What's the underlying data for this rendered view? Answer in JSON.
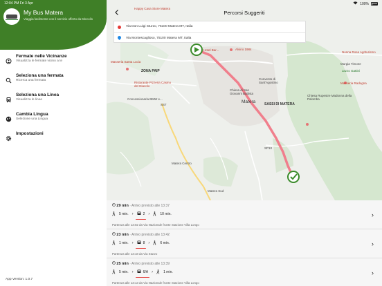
{
  "status_bar": {
    "time": "12:04 PM  Fri 3 Apr",
    "battery": "100%"
  },
  "drawer": {
    "app_title": "My Bus Matera",
    "app_subtitle": "Viaggia facilmente con il servizio offerto da Miccolis",
    "menu": [
      {
        "title": "Fermate nelle Vicinanze",
        "subtitle": "Visualizza le fermate vicino a te",
        "icon": "walking-icon"
      },
      {
        "title": "Seleziona una fermata",
        "subtitle": "Ricerca una fermata",
        "icon": "search-icon"
      },
      {
        "title": "Seleziona una Linea",
        "subtitle": "Visualizza le linee",
        "icon": "bus-icon"
      },
      {
        "title": "Cambia Lingua",
        "subtitle": "Selezione una Lingua",
        "icon": "globe-icon"
      },
      {
        "title": "Impostazioni",
        "subtitle": "",
        "icon": "gear-icon"
      }
    ],
    "version": "App Version: 1.0.7"
  },
  "header": {
    "title": "Percorsi Suggeriti",
    "back_icon": "chevron-left-icon"
  },
  "route": {
    "from": "Via Don Luigi Sturzo, 75100 Matera MT, Italia",
    "to": "Via Montescaglioso, 75100 Matera MT, Italia"
  },
  "map": {
    "labels": {
      "masseria": "Masseria Santa Lucia",
      "zona_paip": "ZONA PAIP",
      "ristorante": "Ristorante Pizzeria Casino del Diavolo",
      "bmw": "Concessionaria BMW e...",
      "matera": "Matera",
      "sassi": "SASSI DI MATERA",
      "convento": "Convento di Sant'Agostino",
      "chiesa": "Chiesa di San Giovanni Battista",
      "alvino": "Alvino 1984",
      "nonna_rosa": "Nonna Rosa Agriturismo",
      "murgia": "Murgia Timone",
      "jazzo": "Jazzo Gattini",
      "campagna": "Masseria Radogna",
      "chiesa_palomba": "Chiesa Rupestre Madonna della Palomba",
      "happy_casa": "Happy Casa Store Matera",
      "ss7": "SS7",
      "sp": "SP10",
      "hotel": "Hotel Bar...",
      "venusio": "Matera Centro",
      "matera_sud": "Matera Sud"
    }
  },
  "trips": [
    {
      "duration": "29 min",
      "arrival": "· Arrivo previsto alle 13:37",
      "walk1": "5 min.",
      "bus": "2",
      "walk2": "10 min.",
      "departure": "Partenza alle 13:02 da Via Nazionale fronte Stazione Villa Longo"
    },
    {
      "duration": "23 min",
      "arrival": "· Arrivo previsto alle 13:42",
      "walk1": "1 min.",
      "bus": "8",
      "walk2": "6 min.",
      "departure": "Partenza alle 13:18 da Via Sturzo"
    },
    {
      "duration": "25 min",
      "arrival": "· Arrivo previsto alle 13:39",
      "walk1": "5 min.",
      "bus": "6/A",
      "walk2": "1 min.",
      "departure": "Partenza alle 13:13 da Via Nazionale fronte Stazione Villa Longo"
    }
  ],
  "colors": {
    "drawer_green": "#3f7f27",
    "route_line": "#f07f8c",
    "accent_red": "#e53935",
    "pin_blue": "#1e88e5"
  }
}
